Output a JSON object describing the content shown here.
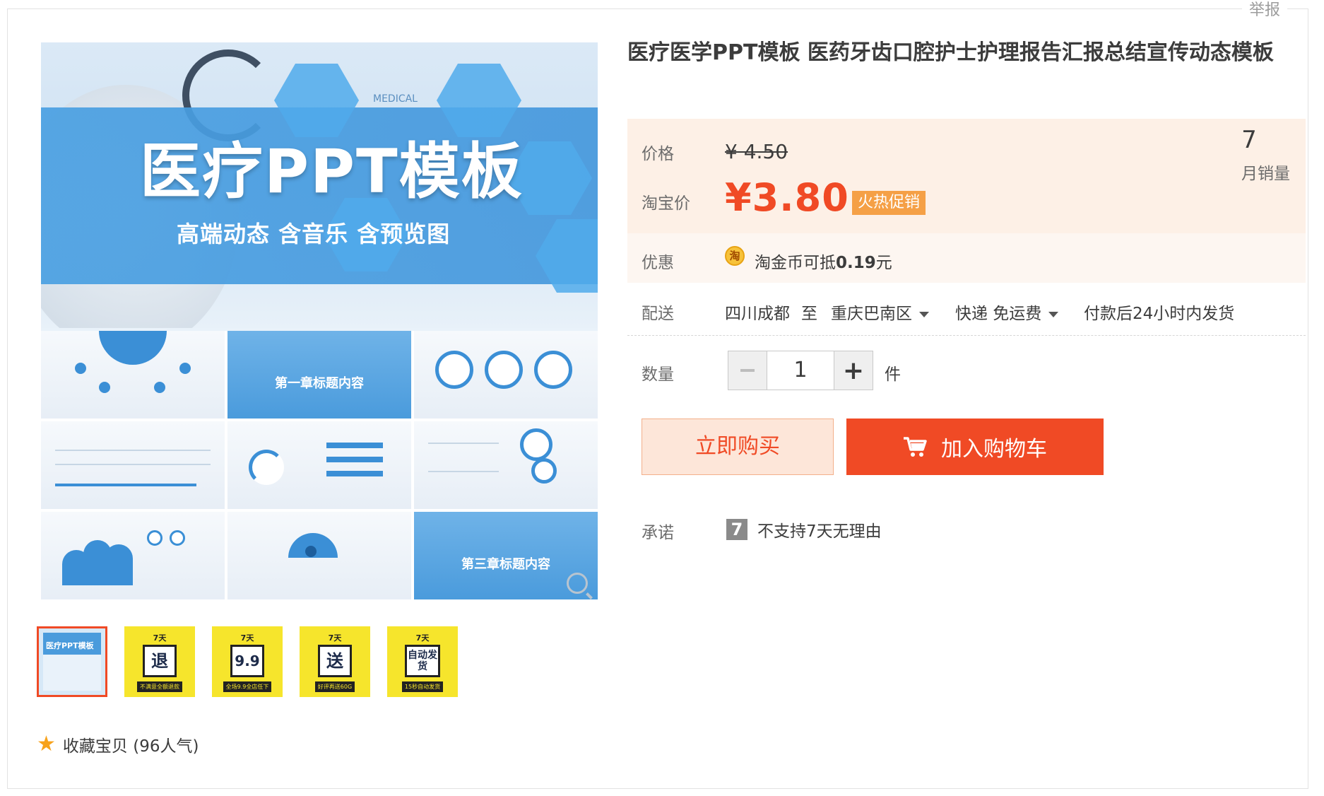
{
  "report_label": "举报",
  "product": {
    "title": "医疗医学PPT模板 医药牙齿口腔护士护理报告汇报总结宣传动态模板",
    "hero_title": "医疗PPT模板",
    "hero_subtitle": "高端动态 含音乐 含预览图",
    "hero_small": "MEDICAL",
    "slide_chapter_1": "第一章标题内容",
    "slide_chapter_3": "第三章标题内容"
  },
  "thumbnails": [
    {
      "type": "preview",
      "label": "医疗PPT模板"
    },
    {
      "type": "badge",
      "badge": "7天",
      "big": "退",
      "strip": "不满意全额退款"
    },
    {
      "type": "badge",
      "badge": "7天",
      "big": "9.9",
      "strip": "全场9.9全店任下"
    },
    {
      "type": "badge",
      "badge": "7天",
      "big": "送",
      "strip": "好评再送60G"
    },
    {
      "type": "badge",
      "badge": "7天",
      "big": "自动发货",
      "strip": "15秒自动发货"
    }
  ],
  "favorite": {
    "label": "收藏宝贝 (96人气)",
    "icon": "star-icon"
  },
  "price": {
    "label": "价格",
    "original": "¥ 4.50",
    "taobao_label": "淘宝价",
    "current": "¥3.80",
    "promo_tag": "火热促销",
    "monthly_sales_value": "7",
    "monthly_sales_label": "月销量"
  },
  "discount": {
    "label": "优惠",
    "coin_icon": "淘",
    "text_prefix": "淘金币可抵",
    "amount": "0.19",
    "unit": "元"
  },
  "delivery": {
    "label": "配送",
    "from": "四川成都",
    "to_word": "至",
    "destination": "重庆巴南区",
    "method": "快递 免运费",
    "ship_time": "付款后24小时内发货"
  },
  "quantity": {
    "label": "数量",
    "value": "1",
    "unit": "件"
  },
  "buttons": {
    "buy_now": "立即购买",
    "add_to_cart": "加入购物车"
  },
  "promise": {
    "label": "承诺",
    "icon_text": "7",
    "text": "不支持7天无理由"
  },
  "colors": {
    "accent": "#f04a25",
    "promo": "#f5a046",
    "price_bg": "#fdf0e6"
  }
}
